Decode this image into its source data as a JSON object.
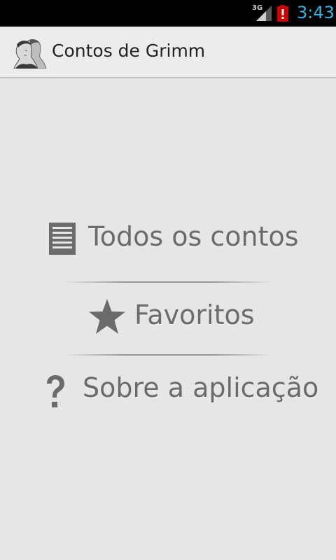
{
  "status_bar": {
    "network": "3G",
    "time": "3:43",
    "time_color": "#33b5e5"
  },
  "action_bar": {
    "title": "Contos de Grimm",
    "logo_icon": "brothers-grimm-portrait-icon"
  },
  "menu": {
    "items": [
      {
        "label": "Todos os contos",
        "icon": "list-document-icon"
      },
      {
        "label": "Favoritos",
        "icon": "star-icon"
      },
      {
        "label": "Sobre a aplicação",
        "icon": "question-mark-icon"
      }
    ]
  },
  "colors": {
    "background": "#e6e6e6",
    "menu_text": "#6b6b6b",
    "status_bar": "#000000"
  }
}
